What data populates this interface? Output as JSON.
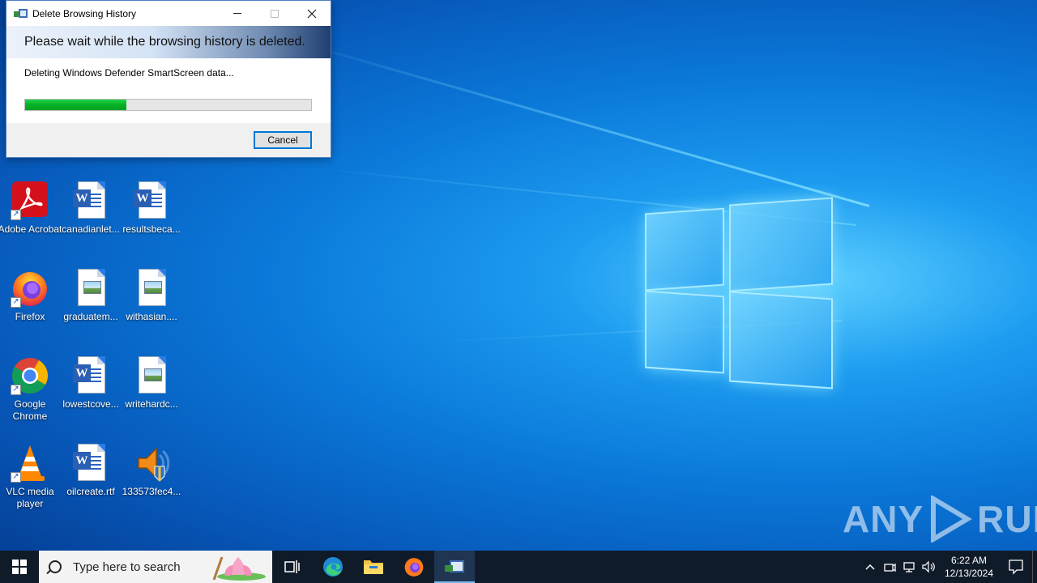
{
  "dialog": {
    "title": "Delete Browsing History",
    "banner": "Please wait while the browsing history is deleted.",
    "status": "Deleting Windows Defender SmartScreen data...",
    "progress_fraction": 0.355,
    "cancel_label": "Cancel"
  },
  "desktop": {
    "icons": [
      {
        "label": "Adobe Acrobat",
        "icon": "adobe-acrobat-icon"
      },
      {
        "label": "canadianlet...",
        "icon": "word-document-icon"
      },
      {
        "label": "resultsbeca...",
        "icon": "word-document-icon"
      },
      {
        "label": "Firefox",
        "icon": "firefox-icon"
      },
      {
        "label": "graduatem...",
        "icon": "image-file-icon"
      },
      {
        "label": "withasian....",
        "icon": "image-file-icon"
      },
      {
        "label": "Google Chrome",
        "icon": "chrome-icon"
      },
      {
        "label": "lowestcove...",
        "icon": "word-document-icon"
      },
      {
        "label": "writehardc...",
        "icon": "image-file-icon"
      },
      {
        "label": "VLC media player",
        "icon": "vlc-icon"
      },
      {
        "label": "oilcreate.rtf",
        "icon": "word-document-icon"
      },
      {
        "label": "133573fec4...",
        "icon": "installer-speaker-icon"
      }
    ]
  },
  "taskbar": {
    "search_placeholder": "Type here to search",
    "time": "6:22 AM",
    "date": "12/13/2024"
  },
  "watermark": {
    "left": "ANY",
    "right": "RUN"
  },
  "colors": {
    "accent": "#0078d7",
    "progress": "#06b025",
    "taskbar": "#101b2a"
  }
}
